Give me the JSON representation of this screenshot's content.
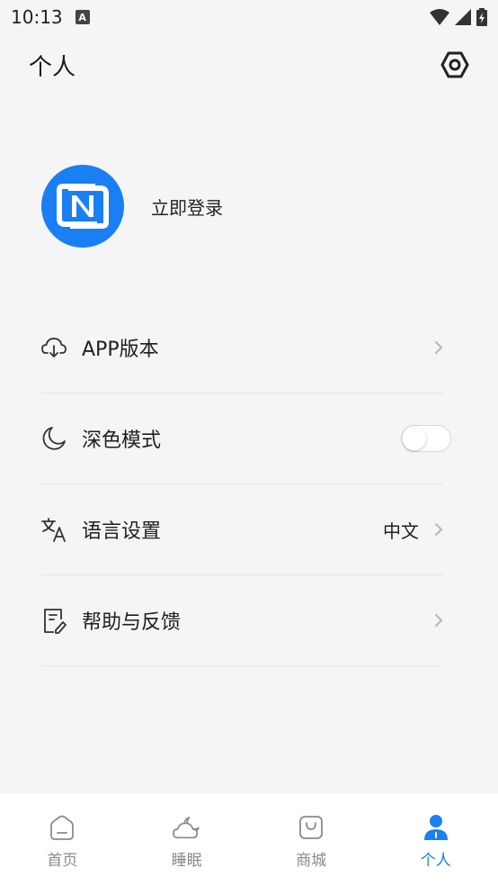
{
  "status_bar": {
    "time": "10:13",
    "notification_badge": "A"
  },
  "header": {
    "title": "个人"
  },
  "profile": {
    "login_label": "立即登录"
  },
  "menu": [
    {
      "label": "APP版本",
      "icon": "cloud-download-icon",
      "value": ""
    },
    {
      "label": "深色模式",
      "icon": "moon-icon",
      "toggle_on": false
    },
    {
      "label": "语言设置",
      "icon": "translate-icon",
      "value": "中文"
    },
    {
      "label": "帮助与反馈",
      "icon": "feedback-icon",
      "value": ""
    }
  ],
  "tabs": [
    {
      "label": "首页",
      "icon": "home-icon",
      "active": false
    },
    {
      "label": "睡眠",
      "icon": "sleep-icon",
      "active": false
    },
    {
      "label": "商城",
      "icon": "shop-bag-icon",
      "active": false
    },
    {
      "label": "个人",
      "icon": "person-icon",
      "active": true
    }
  ],
  "colors": {
    "accent": "#1a7ff2",
    "background": "#f5f5f7",
    "tab_inactive": "#8a8a8e"
  }
}
